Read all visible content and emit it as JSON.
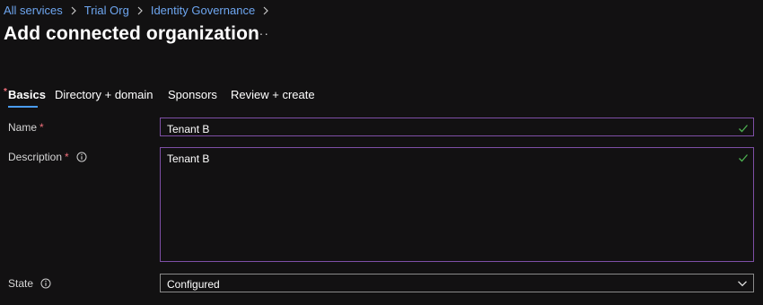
{
  "breadcrumb": {
    "items": [
      "All services",
      "Trial Org",
      "Identity Governance"
    ]
  },
  "page": {
    "title": "Add connected organization",
    "more_label": "···"
  },
  "tabs": [
    {
      "label": "Basics",
      "active": true,
      "required": true
    },
    {
      "label": "Directory + domain",
      "active": false
    },
    {
      "label": "Sponsors",
      "active": false
    },
    {
      "label": "Review + create",
      "active": false
    }
  ],
  "form": {
    "name": {
      "label": "Name",
      "required_mark": "*",
      "value": "Tenant B"
    },
    "description": {
      "label": "Description",
      "required_mark": "*",
      "value": "Tenant B"
    },
    "state": {
      "label": "State",
      "value": "Configured"
    }
  },
  "colors": {
    "link": "#6ea6f0",
    "required": "#f1707b",
    "field_border": "#7e4fa6",
    "valid_check": "#4caf50",
    "tab_underline": "#4a9cf0"
  },
  "icons": {
    "breadcrumb_separator": "chevron-right-icon",
    "valid": "checkmark-icon",
    "info": "info-icon",
    "dropdown": "chevron-down-icon"
  }
}
